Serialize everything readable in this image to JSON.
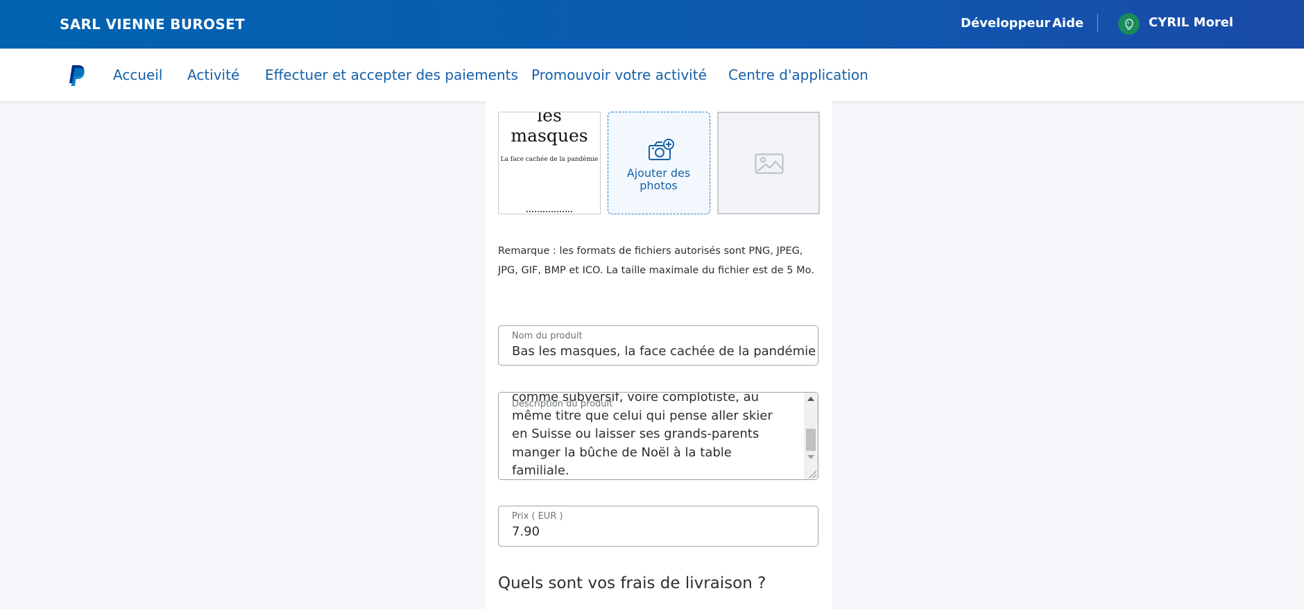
{
  "header": {
    "merchant_name": "SARL VIENNE BUROSET",
    "developer_link": "Développeur",
    "help_link": "Aide",
    "user_name": "CYRIL Morel",
    "avatar_icon": "user-avatar-icon",
    "background_color": "#0d5ab0"
  },
  "nav": {
    "logo_icon": "paypal-logo-icon",
    "items": [
      {
        "label": "Accueil"
      },
      {
        "label": "Activité"
      },
      {
        "label": "Effectuer et accepter des paiements"
      },
      {
        "label": "Promouvoir votre activité"
      },
      {
        "label": "Centre d'application"
      }
    ],
    "link_color": "#1560a8"
  },
  "photos": {
    "book_cover": {
      "title_line1": "les",
      "title_line2": "masques",
      "subtitle": "La face cachée de la pandémie"
    },
    "add_photos_label": "Ajouter des photos",
    "add_icon": "camera-add-icon",
    "placeholder_icon": "image-placeholder-icon"
  },
  "note": "Remarque : les formats de fichiers autorisés sont PNG, JPEG, JPG, GIF, BMP et ICO. La taille maximale du fichier est de 5 Mo.",
  "form": {
    "product_name": {
      "label": "Nom du produit",
      "value": "Bas les masques, la face cachée de la pandémie"
    },
    "description": {
      "label": "Description du produit",
      "value": "comme subversif, voire complotiste, au même titre que celui qui pense aller skier en Suisse ou laisser ses grands-parents manger la bûche de Noël à la table familiale."
    },
    "price": {
      "label": "Prix ( EUR )",
      "value": "7.90"
    }
  },
  "shipping_heading": "Quels sont vos frais de livraison ?"
}
